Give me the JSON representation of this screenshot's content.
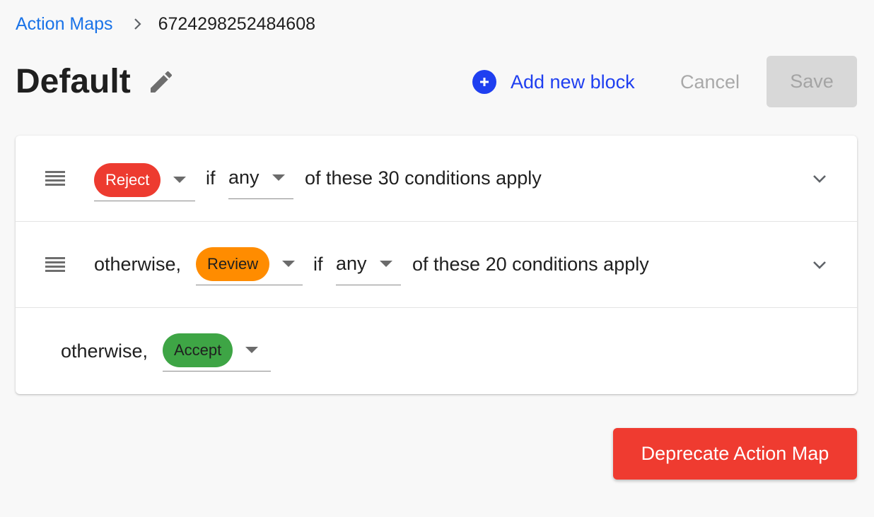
{
  "breadcrumb": {
    "parent": "Action Maps",
    "separator_icon": "chevron-right-icon",
    "current": "6724298252484608"
  },
  "header": {
    "title": "Default",
    "edit_icon": "pencil-icon",
    "add_block_label": "Add new block",
    "add_block_icon": "plus-circle-icon",
    "cancel_label": "Cancel",
    "save_label": "Save"
  },
  "blocks": [
    {
      "prefix": "",
      "action": "Reject",
      "action_color": "#ed3b30",
      "if_label": "if",
      "match": "any",
      "suffix": "of these 30 conditions apply"
    },
    {
      "prefix": "otherwise,",
      "action": "Review",
      "action_color": "#ff8c00",
      "if_label": "if",
      "match": "any",
      "suffix": "of these 20 conditions apply"
    }
  ],
  "default_block": {
    "prefix": "otherwise,",
    "action": "Accept",
    "action_color": "#3ea545"
  },
  "footer": {
    "deprecate_label": "Deprecate Action Map"
  },
  "colors": {
    "link": "#1a73e8",
    "accent": "#1f3ff0",
    "danger": "#ef3b30"
  }
}
